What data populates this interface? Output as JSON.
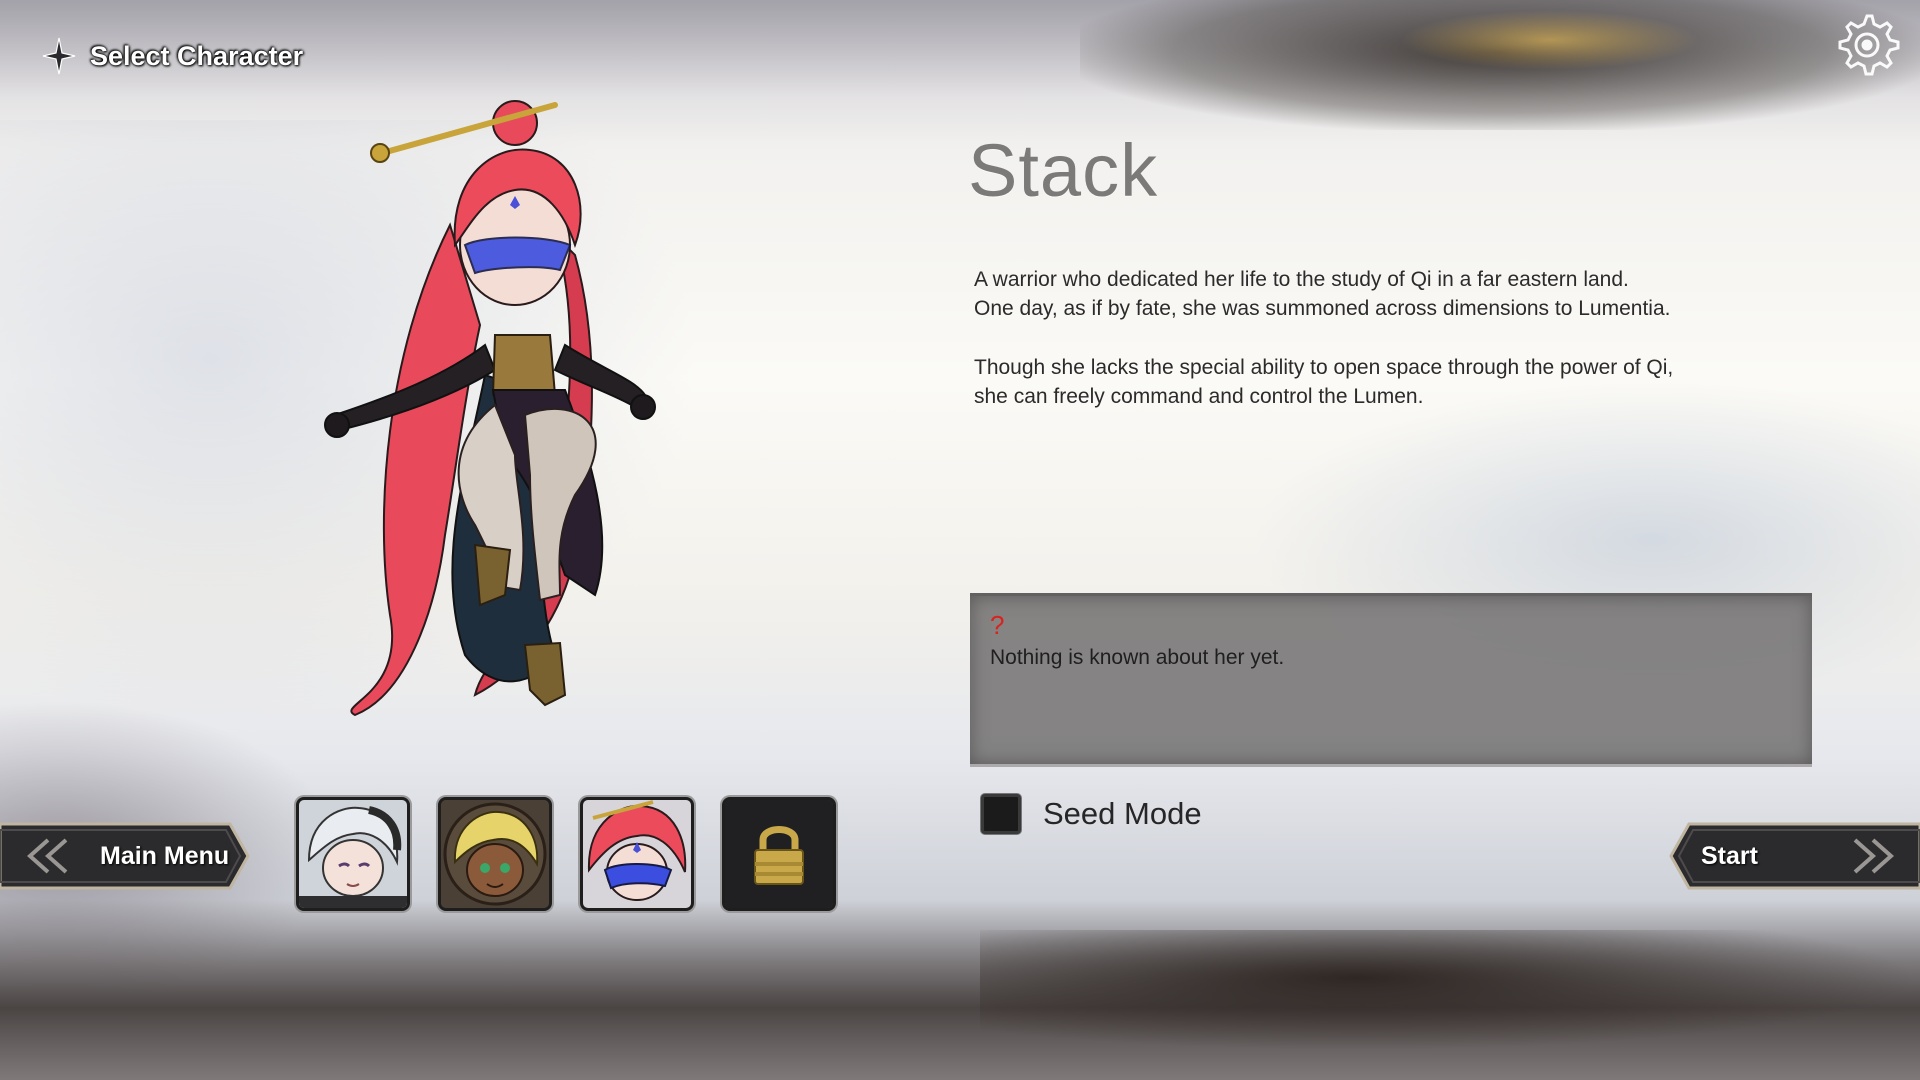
{
  "header": {
    "title": "Select Character",
    "title_icon": "sparkle-icon",
    "settings_icon": "gear-icon"
  },
  "character": {
    "name": "Stack",
    "description": [
      "A warrior who dedicated her life to the study of Qi in a far eastern land.\nOne day, as if by fate, she was summoned across dimensions to Lumentia.",
      "Though she lacks the special ability to open space through the power of Qi,\nshe can freely command and control the Lumen."
    ],
    "unknown_marker": "?",
    "unknown_text": "Nothing is known about her yet."
  },
  "seed_mode": {
    "label": "Seed Mode",
    "checked": false
  },
  "nav": {
    "back_label": "Main Menu",
    "start_label": "Start"
  },
  "portraits": [
    {
      "name": "portrait-silver-haired-character",
      "locked": false
    },
    {
      "name": "portrait-blonde-character",
      "locked": false
    },
    {
      "name": "portrait-stack",
      "locked": false,
      "selected": true
    },
    {
      "name": "portrait-locked",
      "locked": true,
      "icon": "padlock-icon"
    }
  ],
  "colors": {
    "name_text": "#7c7a78",
    "unknown_marker": "#d8231f",
    "panel_bg": "#767474",
    "hair": "#ec4b5c",
    "accent_gold": "#c8a43a"
  }
}
